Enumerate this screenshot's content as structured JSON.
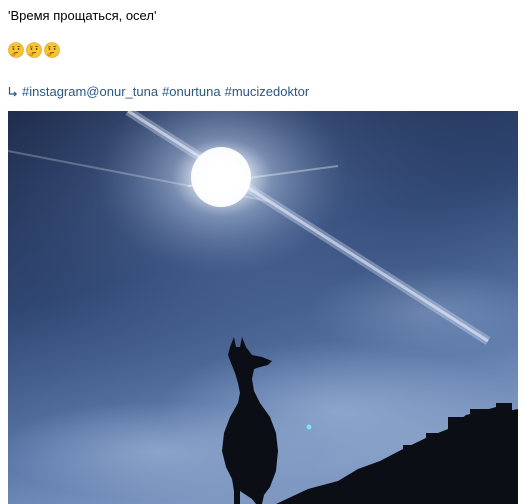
{
  "post": {
    "caption": "'Время прощаться, осел'",
    "emoji": [
      "thinking-face-emoji",
      "thinking-face-emoji",
      "thinking-face-emoji"
    ],
    "tags": [
      "#instagram@onur_tuna",
      "#onurtuna",
      "#mucizedoktor"
    ],
    "photo": {
      "subject": "donkey-silhouette-against-sun",
      "colors": {
        "sky_top": "#1d2a4a",
        "sky_mid": "#3b5585",
        "sky_light": "#8aa5cf",
        "sun": "#ffffff",
        "silhouette": "#0b0e14"
      }
    }
  },
  "colors": {
    "link": "#2a5885",
    "text": "#000000",
    "emoji_face": "#f7c531"
  }
}
